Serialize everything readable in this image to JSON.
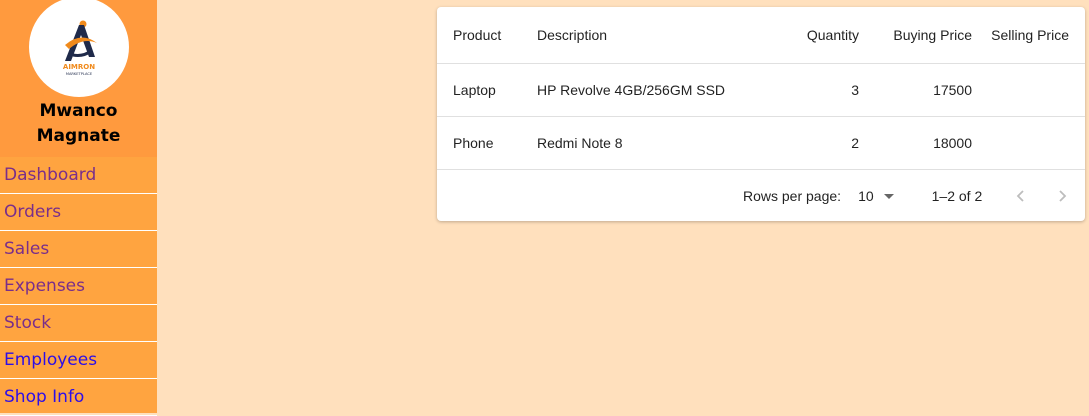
{
  "brand": {
    "logo_text": "AIMRON",
    "logo_subtext": "MARKETPLACE",
    "name": "Mwanco Magnate"
  },
  "nav": [
    {
      "label": "Dashboard"
    },
    {
      "label": "Orders"
    },
    {
      "label": "Sales"
    },
    {
      "label": "Expenses"
    },
    {
      "label": "Stock"
    },
    {
      "label": "Employees"
    },
    {
      "label": "Shop Info"
    }
  ],
  "table": {
    "headers": {
      "product": "Product",
      "description": "Description",
      "quantity": "Quantity",
      "buying_price": "Buying Price",
      "selling_price": "Selling Price"
    },
    "rows": [
      {
        "product": "Laptop",
        "description": "HP Revolve 4GB/256GM SSD",
        "quantity": "3",
        "buying_price": "17500",
        "selling_price": ""
      },
      {
        "product": "Phone",
        "description": "Redmi Note 8",
        "quantity": "2",
        "buying_price": "18000",
        "selling_price": ""
      }
    ]
  },
  "pagination": {
    "rows_per_page_label": "Rows per page:",
    "rows_per_page_value": "10",
    "range": "1–2 of 2"
  },
  "colors": {
    "page_bg": "#ffe0bd",
    "sidebar_bg": "#ffa440",
    "brand_bg": "#ff9a3e",
    "nav_text_purple": "#7a2e8a",
    "nav_text_blue": "#2d0ee8"
  }
}
